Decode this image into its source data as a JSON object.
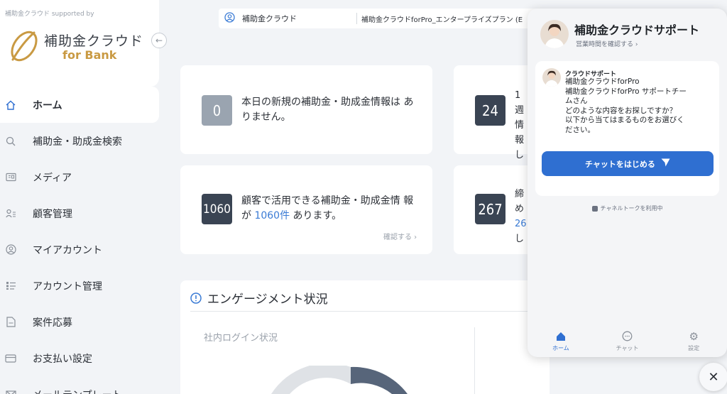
{
  "sidebar": {
    "supported": "補助金クラウド supported by",
    "logo_title": "補助金クラウド",
    "logo_sub": "for Bank",
    "collapse_icon": "arrow-left-icon",
    "items": [
      {
        "label": "ホーム",
        "icon": "home-icon",
        "active": true
      },
      {
        "label": "補助金・助成金検索",
        "icon": "search-icon"
      },
      {
        "label": "メディア",
        "icon": "media-icon"
      },
      {
        "label": "顧客管理",
        "icon": "customers-icon"
      },
      {
        "label": "マイアカウント",
        "icon": "user-icon"
      },
      {
        "label": "アカウント管理",
        "icon": "list-icon"
      },
      {
        "label": "案件応募",
        "icon": "document-icon"
      },
      {
        "label": "お支払い設定",
        "icon": "card-icon"
      },
      {
        "label": "メールテンプレート",
        "icon": "mail-icon"
      }
    ]
  },
  "topbar": {
    "org": "補助金クラウド",
    "plan": "補助金クラウドforPro_エンタープライズプラン (E"
  },
  "cards": [
    {
      "badge": "0",
      "text": "本日の新規の補助金・助成金情報は ありません。"
    },
    {
      "badge": "24",
      "text": "1週 情報 し"
    },
    {
      "badge": "1060",
      "text_before": "顧客で活用できる補助金・助成金情 報が ",
      "highlight": "1060件",
      "text_after": " あります。",
      "link": "確認する ›"
    },
    {
      "badge": "267",
      "text_before": "締め",
      "highlight": "26",
      "text_after": "し"
    }
  ],
  "engagement": {
    "title": "エンゲージメント状況",
    "login_label": "社内ログイン状況"
  },
  "chat": {
    "title": "補助金クラウドサポート",
    "hours": "営業時間を確認する ›",
    "sender": "クラウドサポート",
    "message_lines": [
      "補助金クラウドforPro",
      "補助金クラウドforPro サポートチー",
      "ムさん",
      "どのような内容をお探しですか？",
      "以下から当てはまるものをお選びく",
      "ださい。"
    ],
    "button": "チャットをはじめる",
    "powered": "チャネルトークを利用中",
    "nav": [
      {
        "label": "ホーム",
        "active": true
      },
      {
        "label": "チャット"
      },
      {
        "label": "設定"
      }
    ]
  },
  "colors": {
    "accent": "#2f6fd1",
    "brand_gold": "#c99a43",
    "badge_dark": "#3a4453"
  }
}
